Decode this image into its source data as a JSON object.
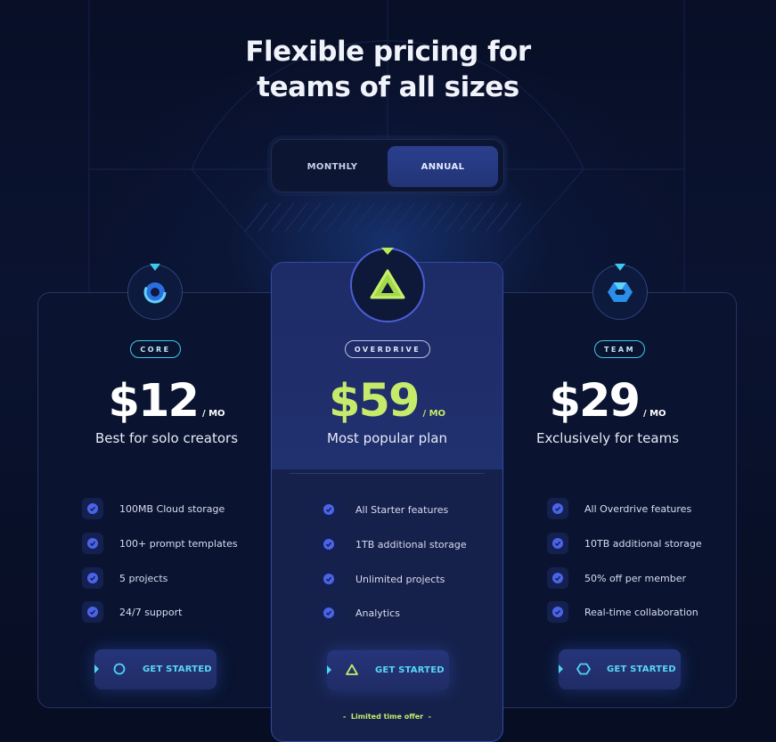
{
  "header": {
    "title_line1": "Flexible pricing for",
    "title_line2": "teams of all sizes"
  },
  "billing_toggle": {
    "monthly_label": "MONTHLY",
    "annual_label": "ANNUAL",
    "selected": "ANNUAL"
  },
  "colors": {
    "accent_cyan": "#3cc9ef",
    "accent_green": "#b9ea5a",
    "check_blue": "#4b63e8",
    "background": "#070d22"
  },
  "plans": [
    {
      "tag": "CORE",
      "price": "$12",
      "period": "/ MO",
      "subtitle": "Best for solo creators",
      "icon": "ring-icon",
      "features": [
        "100MB Cloud storage",
        "100+ prompt templates",
        "5 projects",
        "24/7 support"
      ],
      "cta": "GET STARTED",
      "cta_icon": "circle-icon"
    },
    {
      "tag": "OVERDRIVE",
      "price": "$59",
      "period": "/ MO",
      "subtitle": "Most popular plan",
      "icon": "triangle-icon",
      "features": [
        "All Starter features",
        "1TB additional storage",
        "Unlimited projects",
        "Analytics"
      ],
      "cta": "GET STARTED",
      "cta_icon": "triangle-outline-icon",
      "note": "Limited time offer"
    },
    {
      "tag": "TEAM",
      "price": "$29",
      "period": "/ MO",
      "subtitle": "Exclusively for teams",
      "icon": "hexagon-icon",
      "features": [
        "All Overdrive features",
        "10TB additional storage",
        "50% off per member",
        "Real-time collaboration"
      ],
      "cta": "GET STARTED",
      "cta_icon": "hexagon-outline-icon"
    }
  ]
}
